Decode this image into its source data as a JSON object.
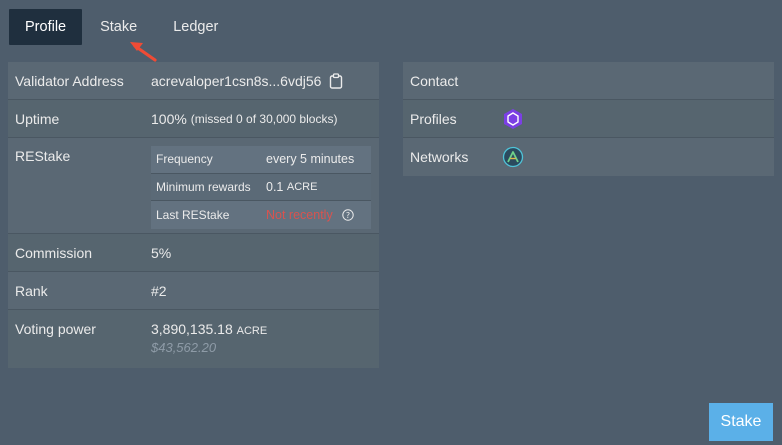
{
  "tabs": [
    {
      "label": "Profile",
      "active": true
    },
    {
      "label": "Stake",
      "active": false
    },
    {
      "label": "Ledger",
      "active": false
    }
  ],
  "left": {
    "validator_address": {
      "label": "Validator Address",
      "value": "acrevaloper1csn8s...6vdj56"
    },
    "uptime": {
      "label": "Uptime",
      "value": "100%",
      "detail": "(missed 0 of 30,000 blocks)"
    },
    "restake": {
      "label": "REStake",
      "rows": [
        {
          "label": "Frequency",
          "value": "every 5 minutes"
        },
        {
          "label": "Minimum rewards",
          "value": "0.1",
          "unit": "ACRE"
        },
        {
          "label": "Last REStake",
          "value": "Not recently"
        }
      ]
    },
    "commission": {
      "label": "Commission",
      "value": "5%"
    },
    "rank": {
      "label": "Rank",
      "value": "#2"
    },
    "voting_power": {
      "label": "Voting power",
      "value": "3,890,135.18",
      "unit": "ACRE",
      "usd": "$43,562.20"
    }
  },
  "right": {
    "contact": {
      "label": "Contact"
    },
    "profiles": {
      "label": "Profiles",
      "icon": "keybase-hex-icon"
    },
    "networks": {
      "label": "Networks",
      "icon": "network-logo-icon"
    }
  },
  "stake_button": {
    "label": "Stake"
  },
  "colors": {
    "background": "#4e5d6c",
    "active_tab": "#1f2f3e",
    "accent": "#5bb0e8",
    "danger": "#d9534f"
  }
}
